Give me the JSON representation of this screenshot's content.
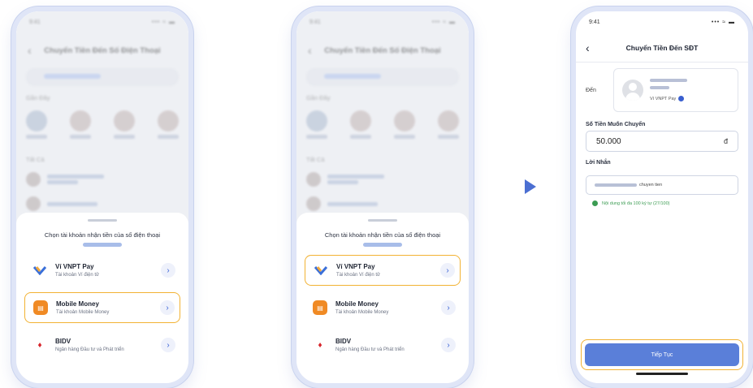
{
  "status_time": "9:41",
  "status_icons": "••• ≈ ▬",
  "list_screen": {
    "title": "Chuyển Tiền Đến Số Điện Thoại",
    "recent_label": "Gần Đây",
    "all_label": "Tất Cả"
  },
  "sheet": {
    "title": "Chọn tài khoản nhận tiền của số điện thoại",
    "options": [
      {
        "name": "Ví VNPT Pay",
        "sub": "Tài khoản Ví điện tử"
      },
      {
        "name": "Mobile Money",
        "sub": "Tài khoản Mobile Money"
      },
      {
        "name": "BIDV",
        "sub": "Ngân hàng Đầu tư và Phát triển"
      }
    ]
  },
  "transfer_screen": {
    "title": "Chuyển Tiền Đến SĐT",
    "to_label": "Đến",
    "wallet_label": "Ví VNPT Pay",
    "amount_label": "Số Tiền Muốn Chuyển",
    "amount_value": "50.000",
    "currency": "đ",
    "message_label": "Lời Nhắn",
    "message_suffix": "chuyen tien",
    "hint": "Nội dung tối đa 100 ký tự (27/100)",
    "next_label": "Tiếp Tục"
  },
  "colors": {
    "accent": "#5a7fd9",
    "highlight": "#f2b233",
    "mobile_money": "#f08a24",
    "bidv": "#d7262c",
    "success": "#3c9c53"
  }
}
